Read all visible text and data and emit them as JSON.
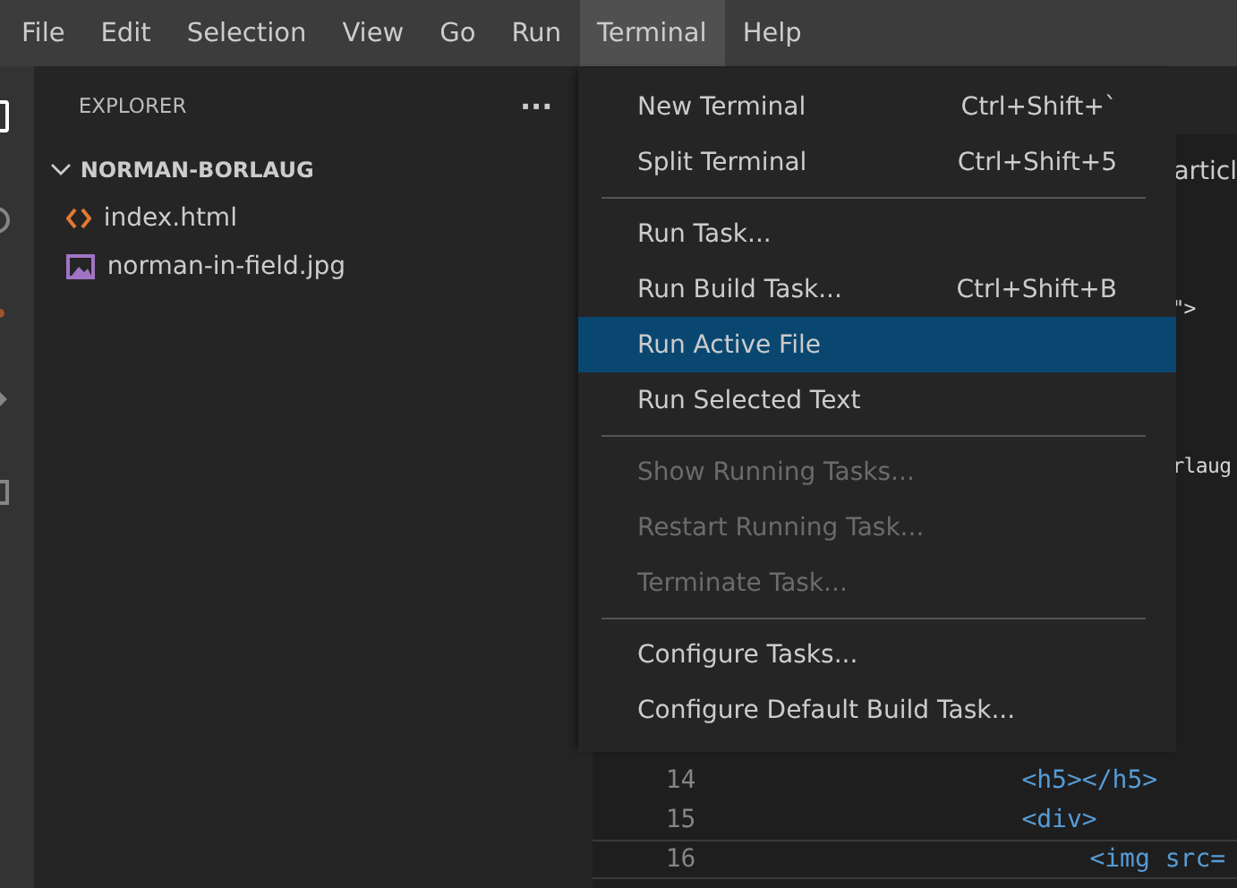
{
  "menubar": [
    {
      "label": "File",
      "selected": false
    },
    {
      "label": "Edit",
      "selected": false
    },
    {
      "label": "Selection",
      "selected": false
    },
    {
      "label": "View",
      "selected": false
    },
    {
      "label": "Go",
      "selected": false
    },
    {
      "label": "Run",
      "selected": false
    },
    {
      "label": "Terminal",
      "selected": true
    },
    {
      "label": "Help",
      "selected": false
    }
  ],
  "sidebar": {
    "title": "EXPLORER",
    "more": "···",
    "folder": {
      "name": "NORMAN-BORLAUG",
      "expanded": true,
      "children": [
        {
          "name": "index.html",
          "kind": "html"
        },
        {
          "name": "norman-in-field.jpg",
          "kind": "image"
        }
      ]
    }
  },
  "editor": {
    "breadcrumb": "articl",
    "rows": [
      {
        "kind": "blank"
      },
      {
        "kind": "blank"
      },
      {
        "kind": "partial",
        "code": "\">"
      },
      {
        "kind": "blank"
      },
      {
        "kind": "blank"
      },
      {
        "kind": "blank"
      },
      {
        "kind": "partial",
        "code": "rlaug"
      },
      {
        "kind": "blank"
      },
      {
        "kind": "blank"
      },
      {
        "kind": "blank"
      },
      {
        "kind": "blank"
      },
      {
        "kind": "blank"
      },
      {
        "kind": "blank"
      },
      {
        "kind": "blank"
      },
      {
        "kind": "line",
        "number": "14",
        "code": "<h5></h5>",
        "current": false
      },
      {
        "kind": "line",
        "number": "15",
        "code": "<div>",
        "current": false,
        "children": [
          {
            "kind": "line",
            "number": "16",
            "code": "<img src=",
            "current": true
          }
        ]
      }
    ]
  },
  "menu": [
    {
      "kind": "item",
      "label": "New Terminal",
      "shortcut": "Ctrl+Shift+`",
      "selected": false,
      "disabled": false
    },
    {
      "kind": "item",
      "label": "Split Terminal",
      "shortcut": "Ctrl+Shift+5",
      "selected": false,
      "disabled": false
    },
    {
      "kind": "separator"
    },
    {
      "kind": "item",
      "label": "Run Task...",
      "selected": false,
      "disabled": false
    },
    {
      "kind": "item",
      "label": "Run Build Task...",
      "shortcut": "Ctrl+Shift+B",
      "selected": false,
      "disabled": false
    },
    {
      "kind": "item",
      "label": "Run Active File",
      "selected": true,
      "disabled": false
    },
    {
      "kind": "item",
      "label": "Run Selected Text",
      "selected": false,
      "disabled": false
    },
    {
      "kind": "separator"
    },
    {
      "kind": "item",
      "label": "Show Running Tasks...",
      "selected": false,
      "disabled": true
    },
    {
      "kind": "item",
      "label": "Restart Running Task...",
      "selected": false,
      "disabled": true
    },
    {
      "kind": "item",
      "label": "Terminate Task...",
      "selected": false,
      "disabled": true
    },
    {
      "kind": "separator"
    },
    {
      "kind": "item",
      "label": "Configure Tasks...",
      "selected": false,
      "disabled": false
    },
    {
      "kind": "item",
      "label": "Configure Default Build Task...",
      "selected": false,
      "disabled": false
    }
  ]
}
